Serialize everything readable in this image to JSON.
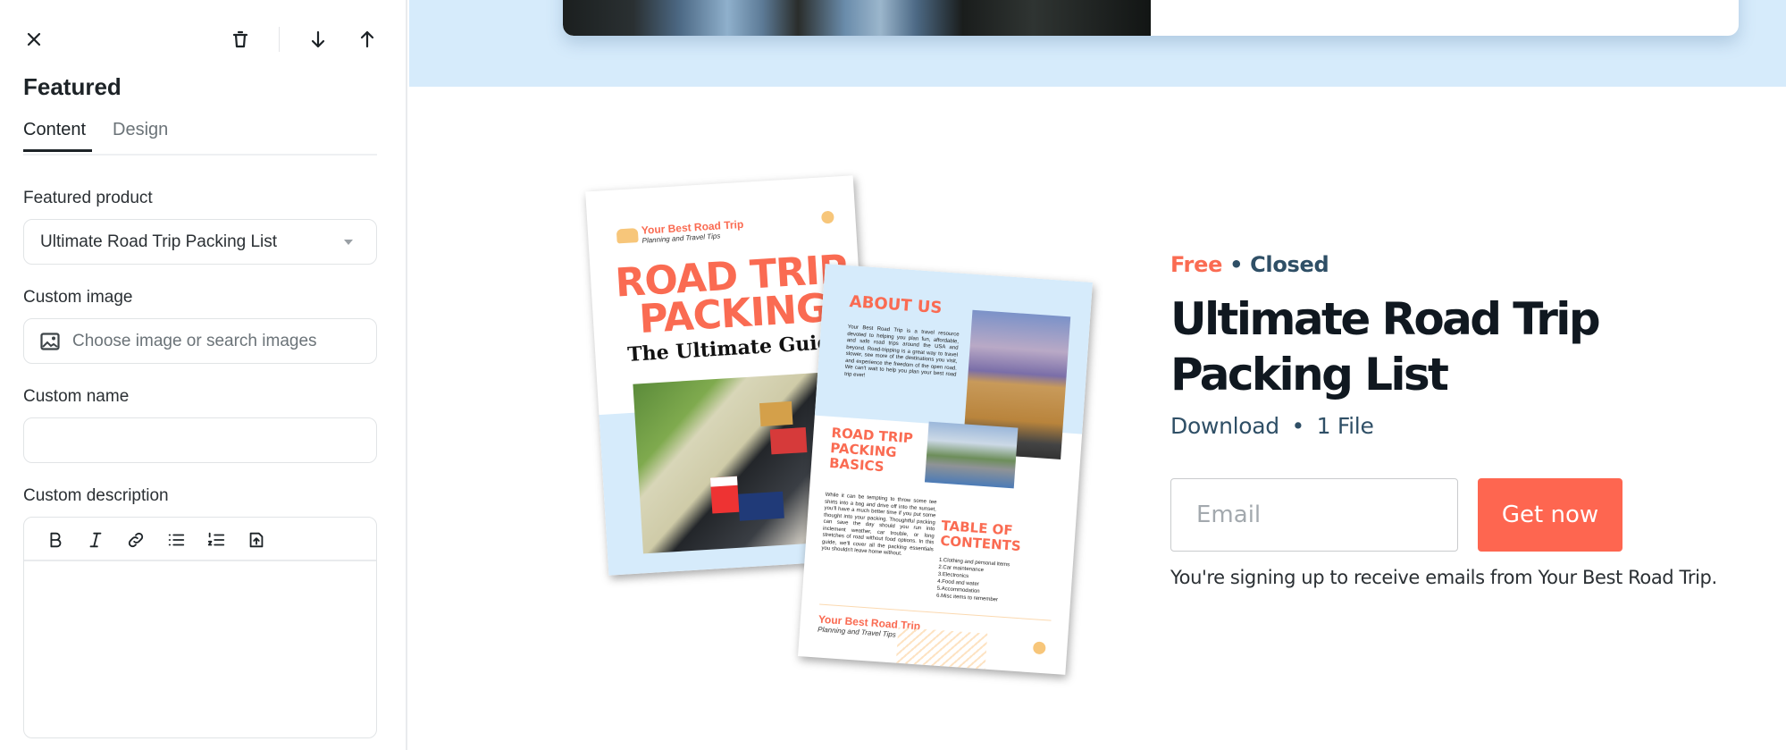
{
  "sidebar": {
    "title": "Featured",
    "toolbar": {
      "close": "close-icon",
      "delete": "trash-icon",
      "move_down": "arrow-down-icon",
      "move_up": "arrow-up-icon"
    },
    "tabs": [
      {
        "label": "Content",
        "active": true
      },
      {
        "label": "Design",
        "active": false
      }
    ],
    "fields": {
      "featured_product": {
        "label": "Featured product",
        "value": "Ultimate Road Trip Packing List"
      },
      "custom_image": {
        "label": "Custom image",
        "placeholder": "Choose image or search images"
      },
      "custom_name": {
        "label": "Custom name",
        "value": ""
      },
      "custom_description": {
        "label": "Custom description",
        "value": "",
        "toolbar": [
          "bold",
          "italic",
          "link",
          "bullet-list",
          "numbered-list",
          "upload-file"
        ]
      }
    }
  },
  "preview": {
    "colors": {
      "accent": "#fe6650",
      "band": "#d6ebfb",
      "meta": "#2f4f66"
    },
    "brochure": {
      "page1": {
        "brand": "Your Best Road Trip",
        "tagline": "Planning and Travel Tips",
        "title_line1": "ROAD TRIP",
        "title_line2": "PACKING",
        "subtitle": "The Ultimate Guide"
      },
      "page2": {
        "about_heading": "ABOUT US",
        "about_text": "Your Best Road Trip is a travel resource devoted to helping you plan fun, affordable, and safe road trips around the USA and beyond. Road-tripping is a great way to travel slower, see more of the destinations you visit, and experience the freedom of the open road. We can't wait to help you plan your best road trip ever!",
        "basics_heading": "ROAD TRIP PACKING BASICS",
        "basics_text": "While it can be tempting to throw some tee shirts into a bag and drive off into the sunset, you'll have a much better time if you put some thought into your packing. Thoughtful packing can save the day should you run into inclement weather, car trouble, or long stretches of road without food options. In this guide, we'll cover all the packing essentials you shouldn't leave home without.",
        "toc_heading": "TABLE OF CONTENTS",
        "toc_items": [
          "1.Clothing and personal items",
          "2.Car maintenance",
          "3.Electronics",
          "4.Food and water",
          "5.Accommodation",
          "6.Misc items to remember"
        ],
        "brand": "Your Best Road Trip",
        "tagline": "Planning and Travel Tips"
      }
    },
    "product": {
      "price": "Free",
      "status": "Closed",
      "separator": "•",
      "title": "Ultimate Road Trip Packing List",
      "type": "Download",
      "files": "1 File",
      "email_placeholder": "Email",
      "cta": "Get now",
      "consent": "You're signing up to receive emails from Your Best Road Trip."
    }
  }
}
